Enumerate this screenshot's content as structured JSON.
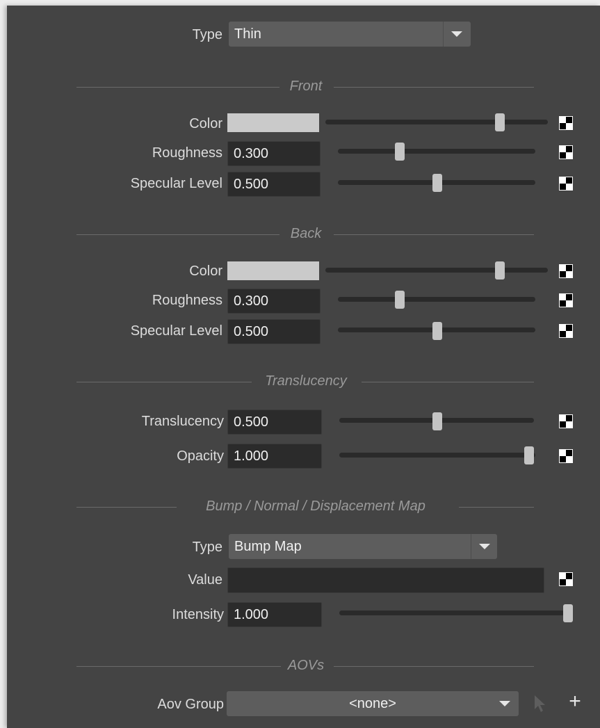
{
  "header": {
    "type_label": "Type",
    "type_value": "Thin"
  },
  "front": {
    "title": "Front",
    "color_label": "Color",
    "color_swatch": "#cacaca",
    "roughness_label": "Roughness",
    "roughness_value": "0.300",
    "specular_label": "Specular Level",
    "specular_value": "0.500"
  },
  "back": {
    "title": "Back",
    "color_label": "Color",
    "color_swatch": "#cacaca",
    "roughness_label": "Roughness",
    "roughness_value": "0.300",
    "specular_label": "Specular Level",
    "specular_value": "0.500"
  },
  "translucency": {
    "title": "Translucency",
    "translucency_label": "Translucency",
    "translucency_value": "0.500",
    "opacity_label": "Opacity",
    "opacity_value": "1.000"
  },
  "bump": {
    "title": "Bump / Normal / Displacement Map",
    "type_label": "Type",
    "type_value": "Bump Map",
    "value_label": "Value",
    "value_value": "",
    "intensity_label": "Intensity",
    "intensity_value": "1.000"
  },
  "aovs": {
    "title": "AOVs",
    "group_label": "Aov Group",
    "group_value": "<none>",
    "add_symbol": "+"
  },
  "icons": {
    "texture_map": "checker-icon",
    "dropdown": "triangle-down-icon",
    "picker": "cursor-arrow-icon",
    "add": "plus-icon"
  }
}
